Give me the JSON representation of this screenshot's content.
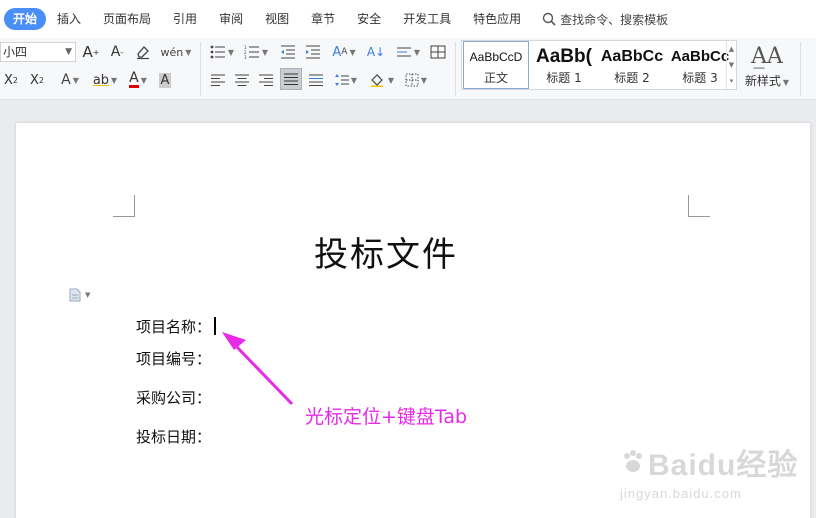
{
  "menu": {
    "tabs": [
      {
        "label": "开始",
        "active": true
      },
      {
        "label": "插入"
      },
      {
        "label": "页面布局"
      },
      {
        "label": "引用"
      },
      {
        "label": "审阅"
      },
      {
        "label": "视图"
      },
      {
        "label": "章节"
      },
      {
        "label": "安全"
      },
      {
        "label": "开发工具"
      },
      {
        "label": "特色应用"
      }
    ],
    "search_label": "查找命令、搜索模板"
  },
  "ribbon": {
    "font_size": "小四",
    "styles": [
      {
        "preview": "AaBbCcD",
        "label": "正文",
        "selected": true
      },
      {
        "preview": "AaBb(",
        "label": "标题 1"
      },
      {
        "preview": "AaBbCc",
        "label": "标题 2"
      },
      {
        "preview": "AaBbCc",
        "label": "标题 3"
      }
    ],
    "new_style_label": "新样式"
  },
  "document": {
    "title": "投标文件",
    "fields": [
      {
        "label": "项目名称："
      },
      {
        "label": "项目编号："
      },
      {
        "label": "采购公司："
      },
      {
        "label": "投标日期："
      }
    ]
  },
  "annotation": {
    "text": "光标定位+键盘Tab",
    "color": "#e62ae6"
  },
  "watermark": {
    "brand": "Baidu经验",
    "url": "jingyan.baidu.com"
  },
  "colors": {
    "accent": "#4a8ef7",
    "annotation": "#e62ae6"
  }
}
